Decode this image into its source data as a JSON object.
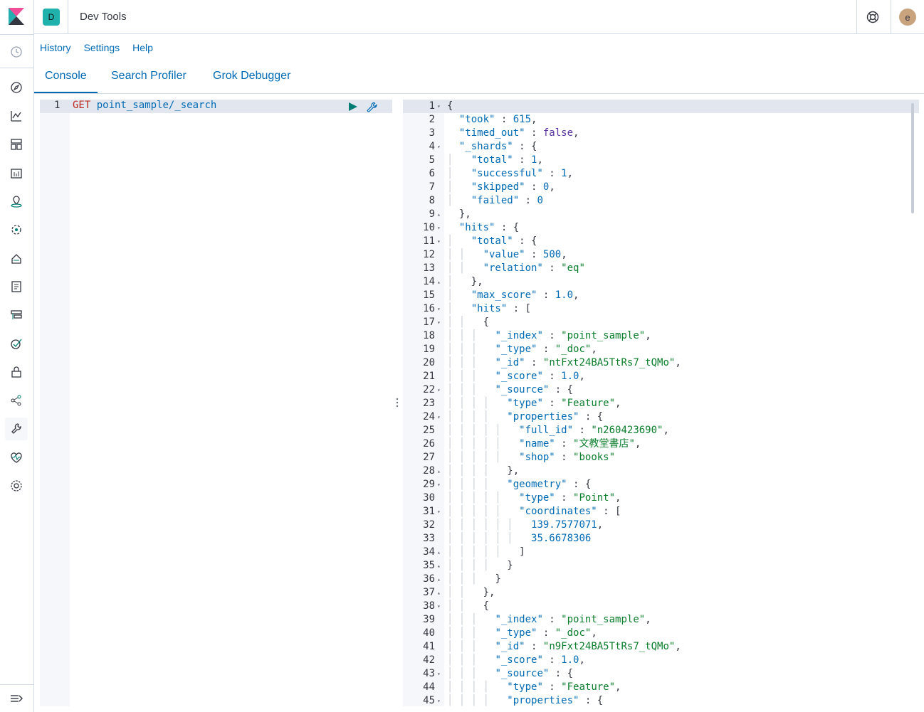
{
  "app": {
    "title": "Dev Tools",
    "space_initial": "D",
    "user_initial": "e"
  },
  "top_links": [
    "History",
    "Settings",
    "Help"
  ],
  "tabs": [
    {
      "label": "Console",
      "active": true
    },
    {
      "label": "Search Profiler",
      "active": false
    },
    {
      "label": "Grok Debugger",
      "active": false
    }
  ],
  "request": {
    "line_number": "1",
    "method": "GET",
    "path": "point_sample/_search"
  },
  "nav_icons": [
    "clock-icon",
    "compass-icon",
    "visualize-icon",
    "dashboard-icon",
    "canvas-icon",
    "maps-icon",
    "ml-icon",
    "infra-icon",
    "logs-icon",
    "apm-icon",
    "uptime-icon",
    "siem-icon",
    "graph-icon",
    "devtools-icon",
    "monitoring-icon",
    "management-icon"
  ],
  "response_lines": [
    {
      "n": "1",
      "f": "▾",
      "d": 0,
      "t": [
        [
          "p",
          "{"
        ]
      ]
    },
    {
      "n": "2",
      "f": "",
      "d": 1,
      "t": [
        [
          "k",
          "\"took\""
        ],
        [
          "p",
          " : "
        ],
        [
          "n",
          "615"
        ],
        [
          "p",
          ","
        ]
      ]
    },
    {
      "n": "3",
      "f": "",
      "d": 1,
      "t": [
        [
          "k",
          "\"timed_out\""
        ],
        [
          "p",
          " : "
        ],
        [
          "b",
          "false"
        ],
        [
          "p",
          ","
        ]
      ]
    },
    {
      "n": "4",
      "f": "▾",
      "d": 1,
      "t": [
        [
          "k",
          "\"_shards\""
        ],
        [
          "p",
          " : {"
        ]
      ]
    },
    {
      "n": "5",
      "f": "",
      "d": 2,
      "t": [
        [
          "k",
          "\"total\""
        ],
        [
          "p",
          " : "
        ],
        [
          "n",
          "1"
        ],
        [
          "p",
          ","
        ]
      ]
    },
    {
      "n": "6",
      "f": "",
      "d": 2,
      "t": [
        [
          "k",
          "\"successful\""
        ],
        [
          "p",
          " : "
        ],
        [
          "n",
          "1"
        ],
        [
          "p",
          ","
        ]
      ]
    },
    {
      "n": "7",
      "f": "",
      "d": 2,
      "t": [
        [
          "k",
          "\"skipped\""
        ],
        [
          "p",
          " : "
        ],
        [
          "n",
          "0"
        ],
        [
          "p",
          ","
        ]
      ]
    },
    {
      "n": "8",
      "f": "",
      "d": 2,
      "t": [
        [
          "k",
          "\"failed\""
        ],
        [
          "p",
          " : "
        ],
        [
          "n",
          "0"
        ]
      ]
    },
    {
      "n": "9",
      "f": "▴",
      "d": 1,
      "t": [
        [
          "p",
          "},"
        ]
      ]
    },
    {
      "n": "10",
      "f": "▾",
      "d": 1,
      "t": [
        [
          "k",
          "\"hits\""
        ],
        [
          "p",
          " : {"
        ]
      ]
    },
    {
      "n": "11",
      "f": "▾",
      "d": 2,
      "t": [
        [
          "k",
          "\"total\""
        ],
        [
          "p",
          " : {"
        ]
      ]
    },
    {
      "n": "12",
      "f": "",
      "d": 3,
      "t": [
        [
          "k",
          "\"value\""
        ],
        [
          "p",
          " : "
        ],
        [
          "n",
          "500"
        ],
        [
          "p",
          ","
        ]
      ]
    },
    {
      "n": "13",
      "f": "",
      "d": 3,
      "t": [
        [
          "k",
          "\"relation\""
        ],
        [
          "p",
          " : "
        ],
        [
          "s",
          "\"eq\""
        ]
      ]
    },
    {
      "n": "14",
      "f": "▴",
      "d": 2,
      "t": [
        [
          "p",
          "},"
        ]
      ]
    },
    {
      "n": "15",
      "f": "",
      "d": 2,
      "t": [
        [
          "k",
          "\"max_score\""
        ],
        [
          "p",
          " : "
        ],
        [
          "n",
          "1.0"
        ],
        [
          "p",
          ","
        ]
      ]
    },
    {
      "n": "16",
      "f": "▾",
      "d": 2,
      "t": [
        [
          "k",
          "\"hits\""
        ],
        [
          "p",
          " : ["
        ]
      ]
    },
    {
      "n": "17",
      "f": "▾",
      "d": 3,
      "t": [
        [
          "p",
          "{"
        ]
      ]
    },
    {
      "n": "18",
      "f": "",
      "d": 4,
      "t": [
        [
          "k",
          "\"_index\""
        ],
        [
          "p",
          " : "
        ],
        [
          "s",
          "\"point_sample\""
        ],
        [
          "p",
          ","
        ]
      ]
    },
    {
      "n": "19",
      "f": "",
      "d": 4,
      "t": [
        [
          "k",
          "\"_type\""
        ],
        [
          "p",
          " : "
        ],
        [
          "s",
          "\"_doc\""
        ],
        [
          "p",
          ","
        ]
      ]
    },
    {
      "n": "20",
      "f": "",
      "d": 4,
      "t": [
        [
          "k",
          "\"_id\""
        ],
        [
          "p",
          " : "
        ],
        [
          "s",
          "\"ntFxt24BA5TtRs7_tQMo\""
        ],
        [
          "p",
          ","
        ]
      ]
    },
    {
      "n": "21",
      "f": "",
      "d": 4,
      "t": [
        [
          "k",
          "\"_score\""
        ],
        [
          "p",
          " : "
        ],
        [
          "n",
          "1.0"
        ],
        [
          "p",
          ","
        ]
      ]
    },
    {
      "n": "22",
      "f": "▾",
      "d": 4,
      "t": [
        [
          "k",
          "\"_source\""
        ],
        [
          "p",
          " : {"
        ]
      ]
    },
    {
      "n": "23",
      "f": "",
      "d": 5,
      "t": [
        [
          "k",
          "\"type\""
        ],
        [
          "p",
          " : "
        ],
        [
          "s",
          "\"Feature\""
        ],
        [
          "p",
          ","
        ]
      ]
    },
    {
      "n": "24",
      "f": "▾",
      "d": 5,
      "t": [
        [
          "k",
          "\"properties\""
        ],
        [
          "p",
          " : {"
        ]
      ]
    },
    {
      "n": "25",
      "f": "",
      "d": 6,
      "t": [
        [
          "k",
          "\"full_id\""
        ],
        [
          "p",
          " : "
        ],
        [
          "s",
          "\"n260423690\""
        ],
        [
          "p",
          ","
        ]
      ]
    },
    {
      "n": "26",
      "f": "",
      "d": 6,
      "t": [
        [
          "k",
          "\"name\""
        ],
        [
          "p",
          " : "
        ],
        [
          "s",
          "\"文教堂書店\""
        ],
        [
          "p",
          ","
        ]
      ]
    },
    {
      "n": "27",
      "f": "",
      "d": 6,
      "t": [
        [
          "k",
          "\"shop\""
        ],
        [
          "p",
          " : "
        ],
        [
          "s",
          "\"books\""
        ]
      ]
    },
    {
      "n": "28",
      "f": "▴",
      "d": 5,
      "t": [
        [
          "p",
          "},"
        ]
      ]
    },
    {
      "n": "29",
      "f": "▾",
      "d": 5,
      "t": [
        [
          "k",
          "\"geometry\""
        ],
        [
          "p",
          " : {"
        ]
      ]
    },
    {
      "n": "30",
      "f": "",
      "d": 6,
      "t": [
        [
          "k",
          "\"type\""
        ],
        [
          "p",
          " : "
        ],
        [
          "s",
          "\"Point\""
        ],
        [
          "p",
          ","
        ]
      ]
    },
    {
      "n": "31",
      "f": "▾",
      "d": 6,
      "t": [
        [
          "k",
          "\"coordinates\""
        ],
        [
          "p",
          " : ["
        ]
      ]
    },
    {
      "n": "32",
      "f": "",
      "d": 7,
      "t": [
        [
          "n",
          "139.7577071"
        ],
        [
          "p",
          ","
        ]
      ]
    },
    {
      "n": "33",
      "f": "",
      "d": 7,
      "t": [
        [
          "n",
          "35.6678306"
        ]
      ]
    },
    {
      "n": "34",
      "f": "▴",
      "d": 6,
      "t": [
        [
          "p",
          "]"
        ]
      ]
    },
    {
      "n": "35",
      "f": "▴",
      "d": 5,
      "t": [
        [
          "p",
          "}"
        ]
      ]
    },
    {
      "n": "36",
      "f": "▴",
      "d": 4,
      "t": [
        [
          "p",
          "}"
        ]
      ]
    },
    {
      "n": "37",
      "f": "▴",
      "d": 3,
      "t": [
        [
          "p",
          "},"
        ]
      ]
    },
    {
      "n": "38",
      "f": "▾",
      "d": 3,
      "t": [
        [
          "p",
          "{"
        ]
      ]
    },
    {
      "n": "39",
      "f": "",
      "d": 4,
      "t": [
        [
          "k",
          "\"_index\""
        ],
        [
          "p",
          " : "
        ],
        [
          "s",
          "\"point_sample\""
        ],
        [
          "p",
          ","
        ]
      ]
    },
    {
      "n": "40",
      "f": "",
      "d": 4,
      "t": [
        [
          "k",
          "\"_type\""
        ],
        [
          "p",
          " : "
        ],
        [
          "s",
          "\"_doc\""
        ],
        [
          "p",
          ","
        ]
      ]
    },
    {
      "n": "41",
      "f": "",
      "d": 4,
      "t": [
        [
          "k",
          "\"_id\""
        ],
        [
          "p",
          " : "
        ],
        [
          "s",
          "\"n9Fxt24BA5TtRs7_tQMo\""
        ],
        [
          "p",
          ","
        ]
      ]
    },
    {
      "n": "42",
      "f": "",
      "d": 4,
      "t": [
        [
          "k",
          "\"_score\""
        ],
        [
          "p",
          " : "
        ],
        [
          "n",
          "1.0"
        ],
        [
          "p",
          ","
        ]
      ]
    },
    {
      "n": "43",
      "f": "▾",
      "d": 4,
      "t": [
        [
          "k",
          "\"_source\""
        ],
        [
          "p",
          " : {"
        ]
      ]
    },
    {
      "n": "44",
      "f": "",
      "d": 5,
      "t": [
        [
          "k",
          "\"type\""
        ],
        [
          "p",
          " : "
        ],
        [
          "s",
          "\"Feature\""
        ],
        [
          "p",
          ","
        ]
      ]
    },
    {
      "n": "45",
      "f": "▾",
      "d": 5,
      "t": [
        [
          "k",
          "\"properties\""
        ],
        [
          "p",
          " : {"
        ]
      ]
    }
  ],
  "colors": {
    "link": "#006bb4",
    "method": "#bd271e",
    "string": "#0a7d2c",
    "boolean": "#5a32a3",
    "accent_teal": "#20b2aa"
  }
}
